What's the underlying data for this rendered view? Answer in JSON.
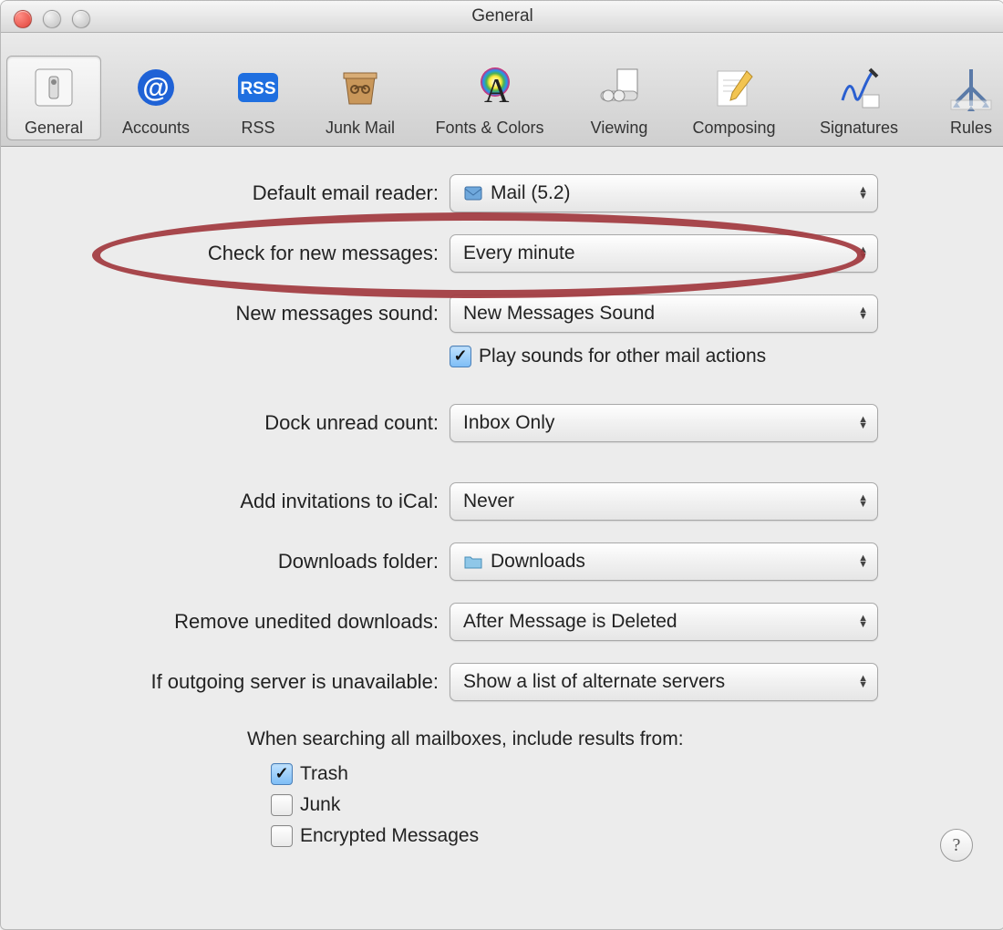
{
  "window": {
    "title": "General"
  },
  "toolbar": {
    "items": [
      {
        "label": "General",
        "icon": "switch-icon",
        "selected": true
      },
      {
        "label": "Accounts",
        "icon": "at-icon"
      },
      {
        "label": "RSS",
        "icon": "rss-icon"
      },
      {
        "label": "Junk Mail",
        "icon": "junk-icon"
      },
      {
        "label": "Fonts & Colors",
        "icon": "fonts-icon"
      },
      {
        "label": "Viewing",
        "icon": "viewing-icon"
      },
      {
        "label": "Composing",
        "icon": "composing-icon"
      },
      {
        "label": "Signatures",
        "icon": "signatures-icon"
      },
      {
        "label": "Rules",
        "icon": "rules-icon"
      }
    ]
  },
  "fields": {
    "default_reader": {
      "label": "Default email reader:",
      "value": "Mail (5.2)"
    },
    "check_messages": {
      "label": "Check for new messages:",
      "value": "Every minute"
    },
    "new_sound": {
      "label": "New messages sound:",
      "value": "New Messages Sound"
    },
    "play_sounds": {
      "label": "Play sounds for other mail actions",
      "checked": true
    },
    "dock_unread": {
      "label": "Dock unread count:",
      "value": "Inbox Only"
    },
    "add_ical": {
      "label": "Add invitations to iCal:",
      "value": "Never"
    },
    "downloads_folder": {
      "label": "Downloads folder:",
      "value": "Downloads"
    },
    "remove_downloads": {
      "label": "Remove unedited downloads:",
      "value": "After Message is Deleted"
    },
    "outgoing_unavailable": {
      "label": "If outgoing server is unavailable:",
      "value": "Show a list of alternate servers"
    }
  },
  "search_section": {
    "title": "When searching all mailboxes, include results from:",
    "options": [
      {
        "label": "Trash",
        "checked": true
      },
      {
        "label": "Junk",
        "checked": false
      },
      {
        "label": "Encrypted Messages",
        "checked": false
      }
    ]
  },
  "help_label": "?"
}
